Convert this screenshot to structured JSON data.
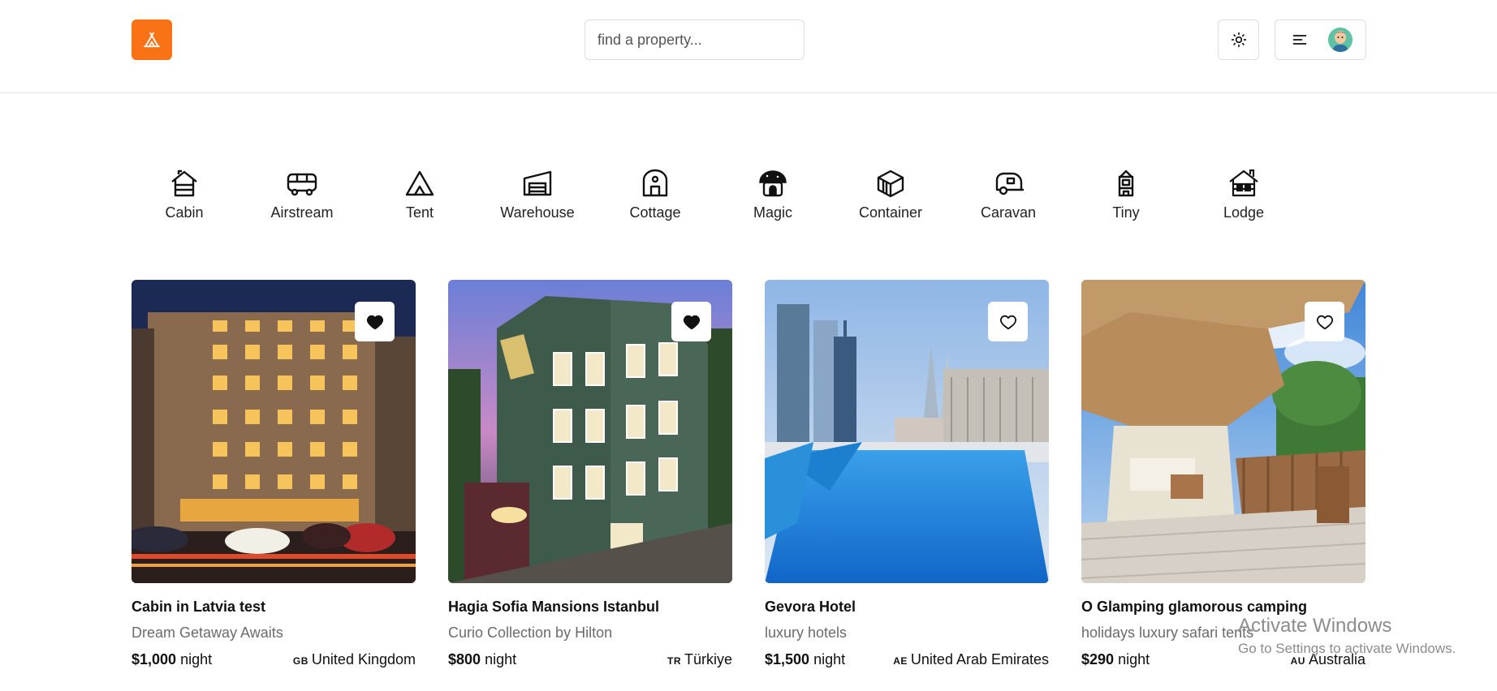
{
  "header": {
    "logo_icon": "tent-icon",
    "accent_color": "#f97316",
    "search_placeholder": "find a property...",
    "theme_icon": "sun-icon",
    "menu_icon": "menu-lines-icon",
    "avatar_icon": "user-avatar"
  },
  "categories": [
    {
      "label": "Cabin",
      "icon": "cabin-icon"
    },
    {
      "label": "Airstream",
      "icon": "bus-icon"
    },
    {
      "label": "Tent",
      "icon": "tent-icon"
    },
    {
      "label": "Warehouse",
      "icon": "warehouse-icon"
    },
    {
      "label": "Cottage",
      "icon": "cottage-icon"
    },
    {
      "label": "Magic",
      "icon": "mushroom-house-icon"
    },
    {
      "label": "Container",
      "icon": "container-icon"
    },
    {
      "label": "Caravan",
      "icon": "caravan-icon"
    },
    {
      "label": "Tiny",
      "icon": "tiny-house-icon"
    },
    {
      "label": "Lodge",
      "icon": "lodge-icon"
    }
  ],
  "listings": [
    {
      "title": "Cabin in Latvia test",
      "subtitle": "Dream Getaway Awaits",
      "price": "$1,000",
      "per": "night",
      "country_code": "GB",
      "country": "United Kingdom",
      "favorited": true
    },
    {
      "title": "Hagia Sofia Mansions Istanbul",
      "subtitle": "Curio Collection by Hilton",
      "price": "$800",
      "per": "night",
      "country_code": "TR",
      "country": "Türkiye",
      "favorited": true
    },
    {
      "title": "Gevora Hotel",
      "subtitle": "luxury hotels",
      "price": "$1,500",
      "per": "night",
      "country_code": "AE",
      "country": "United Arab Emirates",
      "favorited": false
    },
    {
      "title": "O Glamping glamorous camping",
      "subtitle": "holidays luxury safari tents",
      "price": "$290",
      "per": "night",
      "country_code": "AU",
      "country": "Australia",
      "favorited": false
    }
  ],
  "watermark": {
    "title": "Activate Windows",
    "subtitle": "Go to Settings to activate Windows."
  }
}
